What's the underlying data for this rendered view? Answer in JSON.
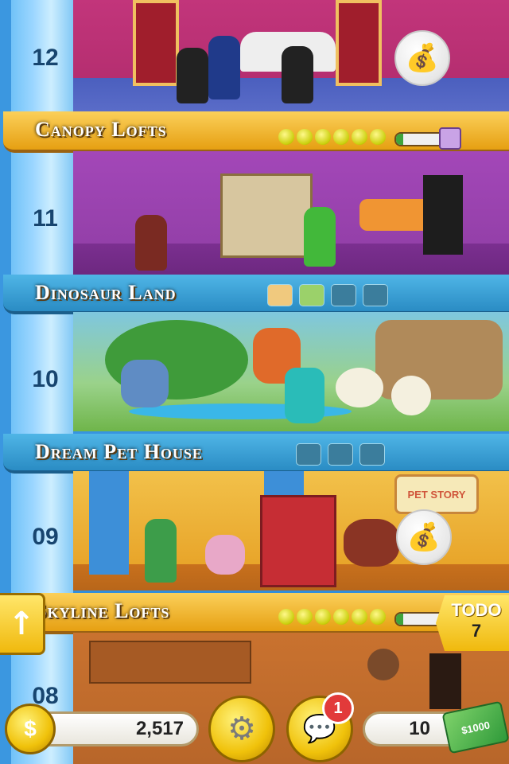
{
  "floors": [
    {
      "number": "12",
      "name": "Canopy Lofts",
      "bubble_icon": "money-bag-icon",
      "stars": 6,
      "progress": 0.15
    },
    {
      "number": "11",
      "name": "Dinosaur Land",
      "slots_icons": [
        "money-bag-icon",
        "dinosaur-icon"
      ]
    },
    {
      "number": "10",
      "name": "Dream Pet House"
    },
    {
      "number": "09",
      "name": "Skyline Lofts",
      "bubble_icon": "money-bag-icon",
      "stars": 6,
      "progress": 0.15
    },
    {
      "number": "08"
    }
  ],
  "hud": {
    "coins_value": "2,517",
    "bux_value": "10",
    "notification_count": "1",
    "todo_label": "TODO",
    "todo_count": "7",
    "bux_note_label": "$1000",
    "pet_sign_text": "PET STORY"
  },
  "colors": {
    "banner_gold": "#f3b41e",
    "banner_blue": "#3aa0d4",
    "star_yellow": "#d9df0e",
    "rail_blue": "#5bb8f4"
  }
}
